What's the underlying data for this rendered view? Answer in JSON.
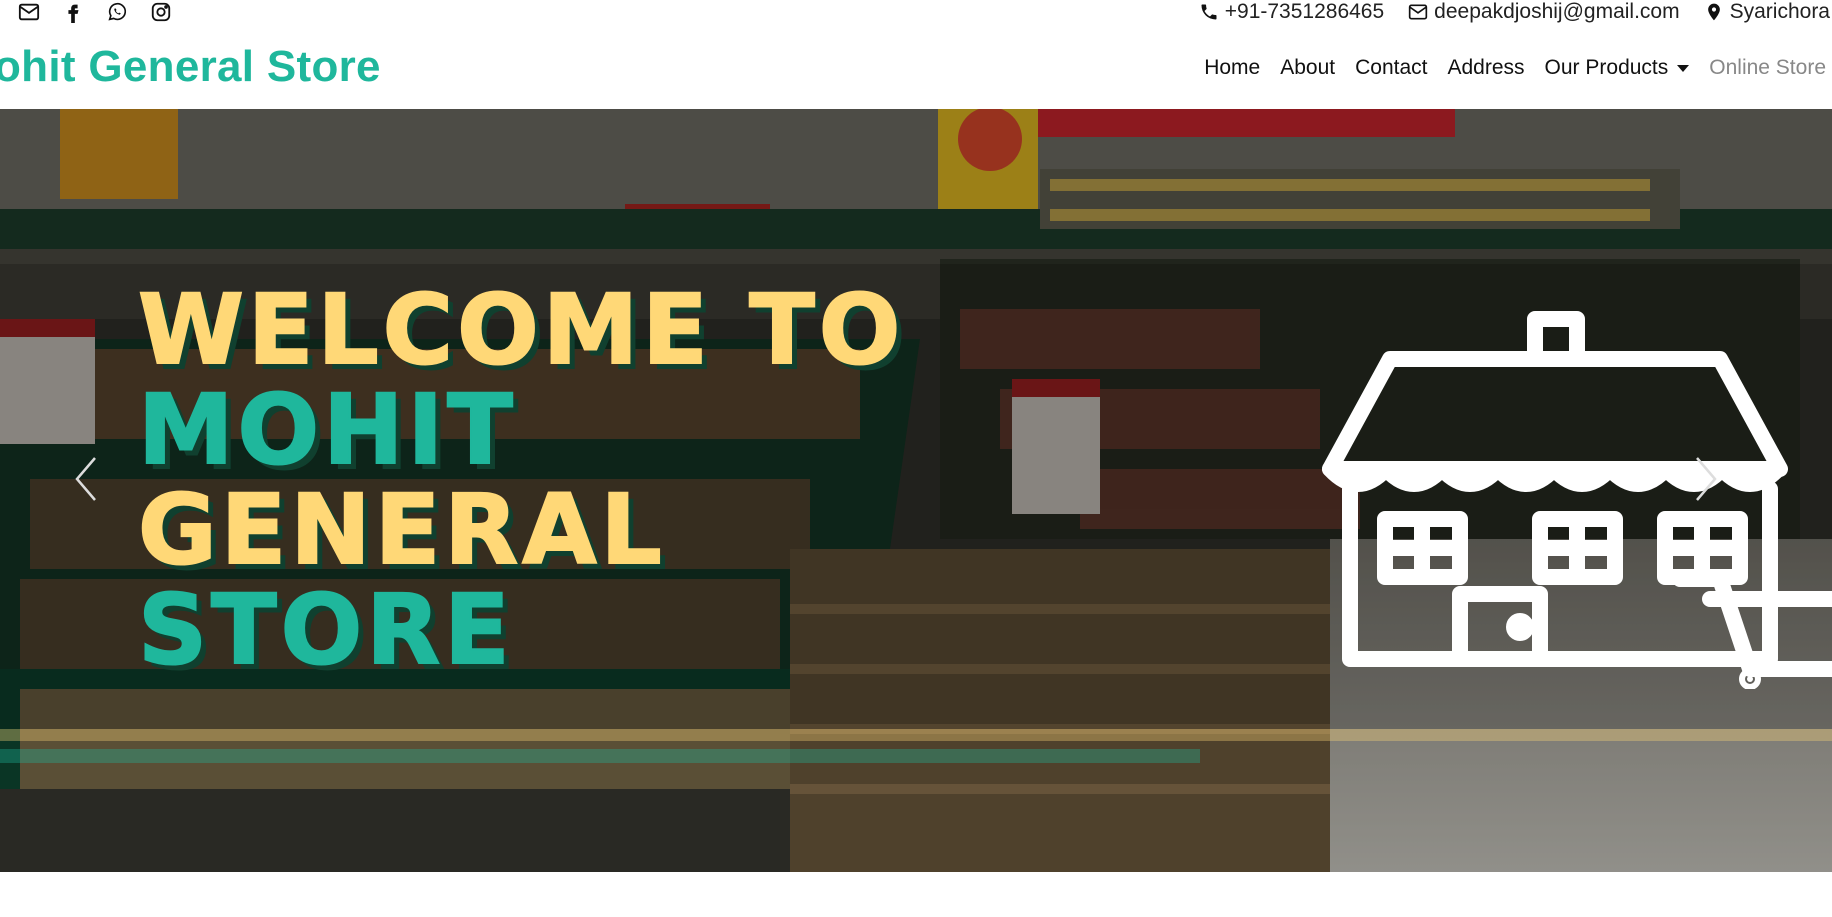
{
  "topbar": {
    "social": [
      {
        "icon": "envelope-icon"
      },
      {
        "icon": "facebook-icon"
      },
      {
        "icon": "whatsapp-icon"
      },
      {
        "icon": "instagram-icon"
      }
    ],
    "phone": "+91-7351286465",
    "email": "deepakdjoshij@gmail.com",
    "location": "Syarichora"
  },
  "navbar": {
    "brand": "ohit General Store",
    "links": {
      "home": "Home",
      "about": "About",
      "contact": "Contact",
      "address": "Address",
      "products": "Our Products",
      "online": "Online Store"
    }
  },
  "hero": {
    "line1": "WELCOME TO",
    "line2": "MOHIT",
    "line3": "GENERAL",
    "line4": "STORE",
    "colors": {
      "yellow": "#ffd877",
      "green": "#1fb79c",
      "brand": "#1fb79c"
    },
    "icons": [
      "chevron-left-icon",
      "chevron-right-icon",
      "store-cart-icon"
    ]
  }
}
